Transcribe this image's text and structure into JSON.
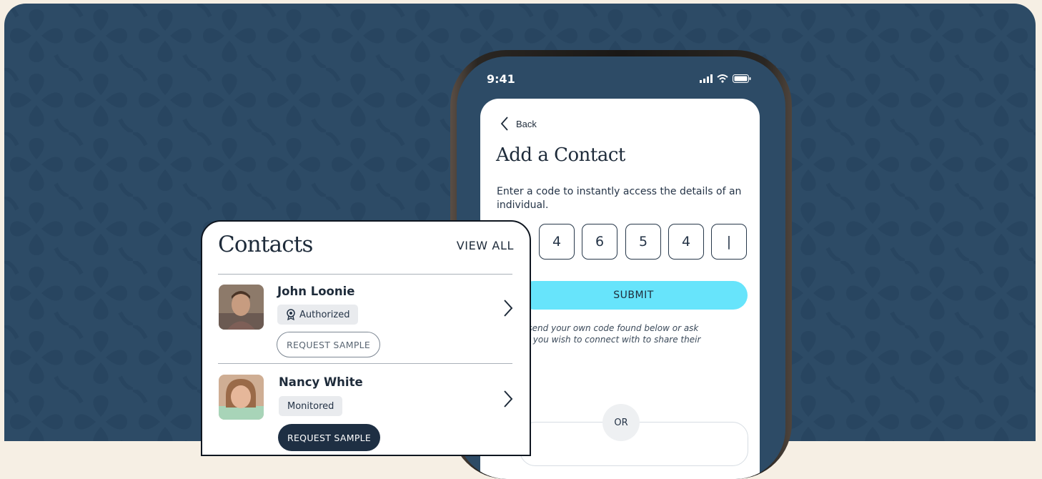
{
  "phone": {
    "time": "9:41",
    "status_icons": [
      "cellular-signal-icon",
      "wifi-icon",
      "battery-icon"
    ],
    "back_label": "Back",
    "title": "Add a Contact",
    "description": "Enter a code to instantly access the details of an individual.",
    "code_digits": [
      "4",
      "6",
      "5",
      "4",
      "|"
    ],
    "submit_label": "SUBMIT",
    "note_line1": "n send your own code found below or ask",
    "note_line2": "on you wish to connect with to share their",
    "or_label": "OR"
  },
  "contacts": {
    "title": "Contacts",
    "view_all_label": "VIEW ALL",
    "items": [
      {
        "name": "John Loonie",
        "status": "Authorized",
        "status_icon": "award-ribbon-icon",
        "action": "REQUEST SAMPLE",
        "action_style": "outline"
      },
      {
        "name": "Nancy White",
        "status": "Monitored",
        "action": "REQUEST SAMPLE",
        "action_style": "filled"
      }
    ]
  },
  "colors": {
    "background": "#2d4b66",
    "accent": "#67e4fb",
    "dark_button": "#1e2f43",
    "text": "#1e2b3a"
  }
}
